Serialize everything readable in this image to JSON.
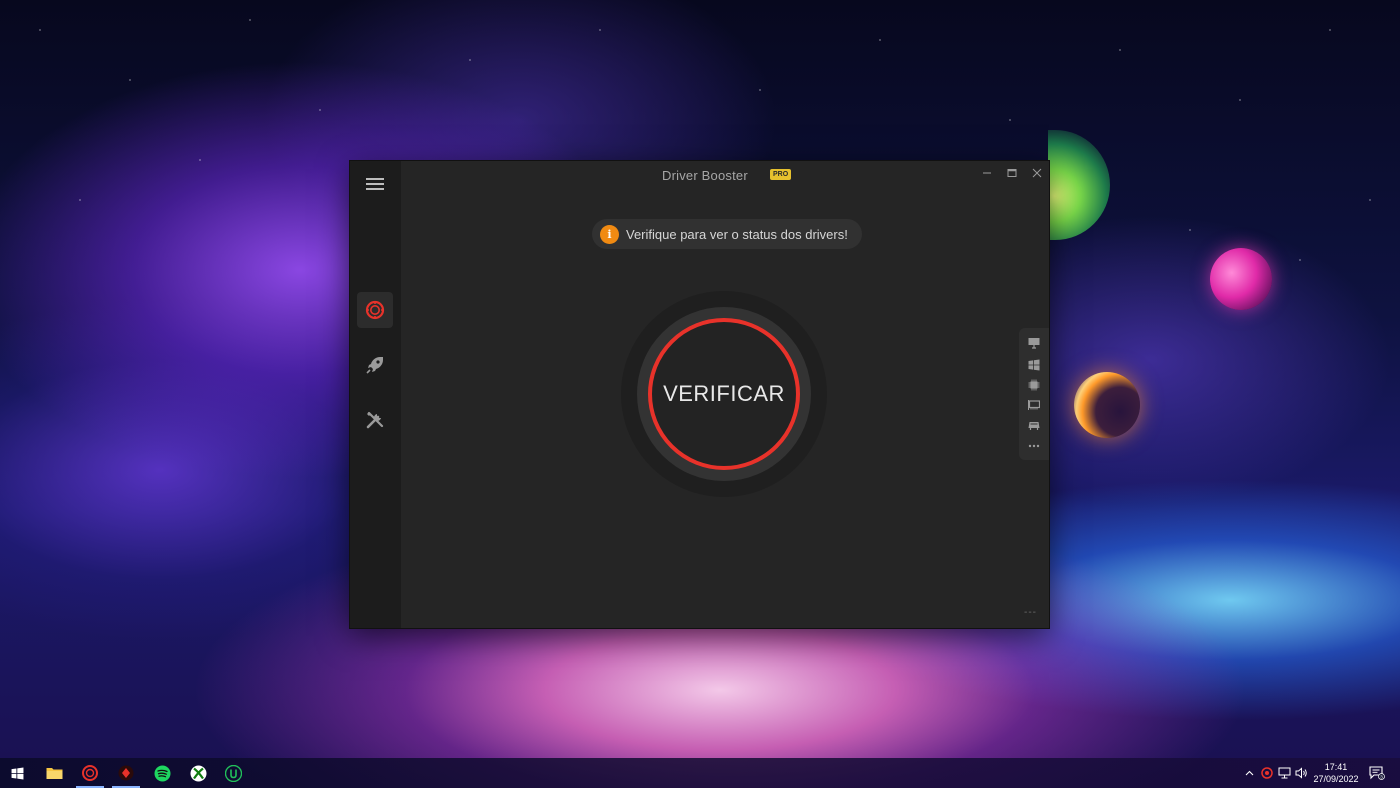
{
  "app": {
    "title": "Driver Booster",
    "badge": "PRO",
    "status_icon": "i",
    "status_message": "Verifique para ver o status dos drivers!",
    "scan_label": "VERIFICAR",
    "footer_text": "---",
    "accent_color": "#e8322a",
    "status_color": "#f08a12",
    "nav_items": [
      {
        "id": "scan",
        "icon": "driver-scan-icon",
        "active": true
      },
      {
        "id": "boost",
        "icon": "rocket-icon",
        "active": false
      },
      {
        "id": "tools",
        "icon": "tools-icon",
        "active": false
      }
    ],
    "right_panel_icons": [
      "display-icon",
      "windows-icon",
      "chip-icon",
      "network-card-icon",
      "gaming-icon",
      "more-icon"
    ],
    "window_controls": [
      "minimize",
      "maximize",
      "close"
    ]
  },
  "taskbar": {
    "apps": [
      "start-icon",
      "file-explorer-icon",
      "driver-booster-icon",
      "iobit-icon",
      "spotify-icon",
      "xbox-icon",
      "upwork-icon"
    ],
    "time": "17:41",
    "date": "27/09/2022",
    "notification_count": "3"
  }
}
